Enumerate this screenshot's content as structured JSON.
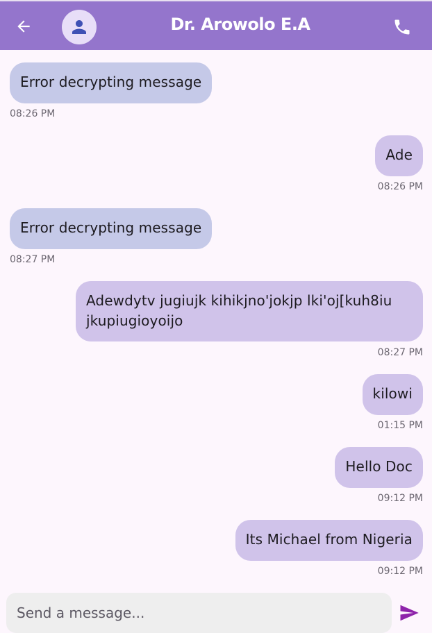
{
  "header": {
    "back_icon": "arrow-back-icon",
    "avatar_icon": "person-icon",
    "title": "Dr. Arowolo E.A",
    "call_icon": "phone-icon",
    "bar_color": "#9475cc"
  },
  "messages": [
    {
      "direction": "in",
      "text": "Error decrypting message",
      "time": "08:26 PM"
    },
    {
      "direction": "out",
      "text": "Ade",
      "time": "08:26 PM"
    },
    {
      "direction": "in",
      "text": "Error decrypting message",
      "time": "08:27 PM"
    },
    {
      "direction": "out",
      "text": "Adewdytv jugiujk kihikjno'jokjp lki'oj[kuh8iu jkupiugioyoijo",
      "time": "08:27 PM"
    },
    {
      "direction": "out",
      "text": "kilowi",
      "time": "01:15 PM"
    },
    {
      "direction": "out",
      "text": "Hello Doc",
      "time": "09:12 PM"
    },
    {
      "direction": "out",
      "text": "Its Michael from Nigeria",
      "time": "09:12 PM"
    }
  ],
  "composer": {
    "placeholder": "Send a message...",
    "send_icon": "send-icon"
  },
  "colors": {
    "incoming_bubble": "#c5c9e8",
    "outgoing_bubble": "#d0c3ea",
    "send_icon": "#8e24aa"
  }
}
